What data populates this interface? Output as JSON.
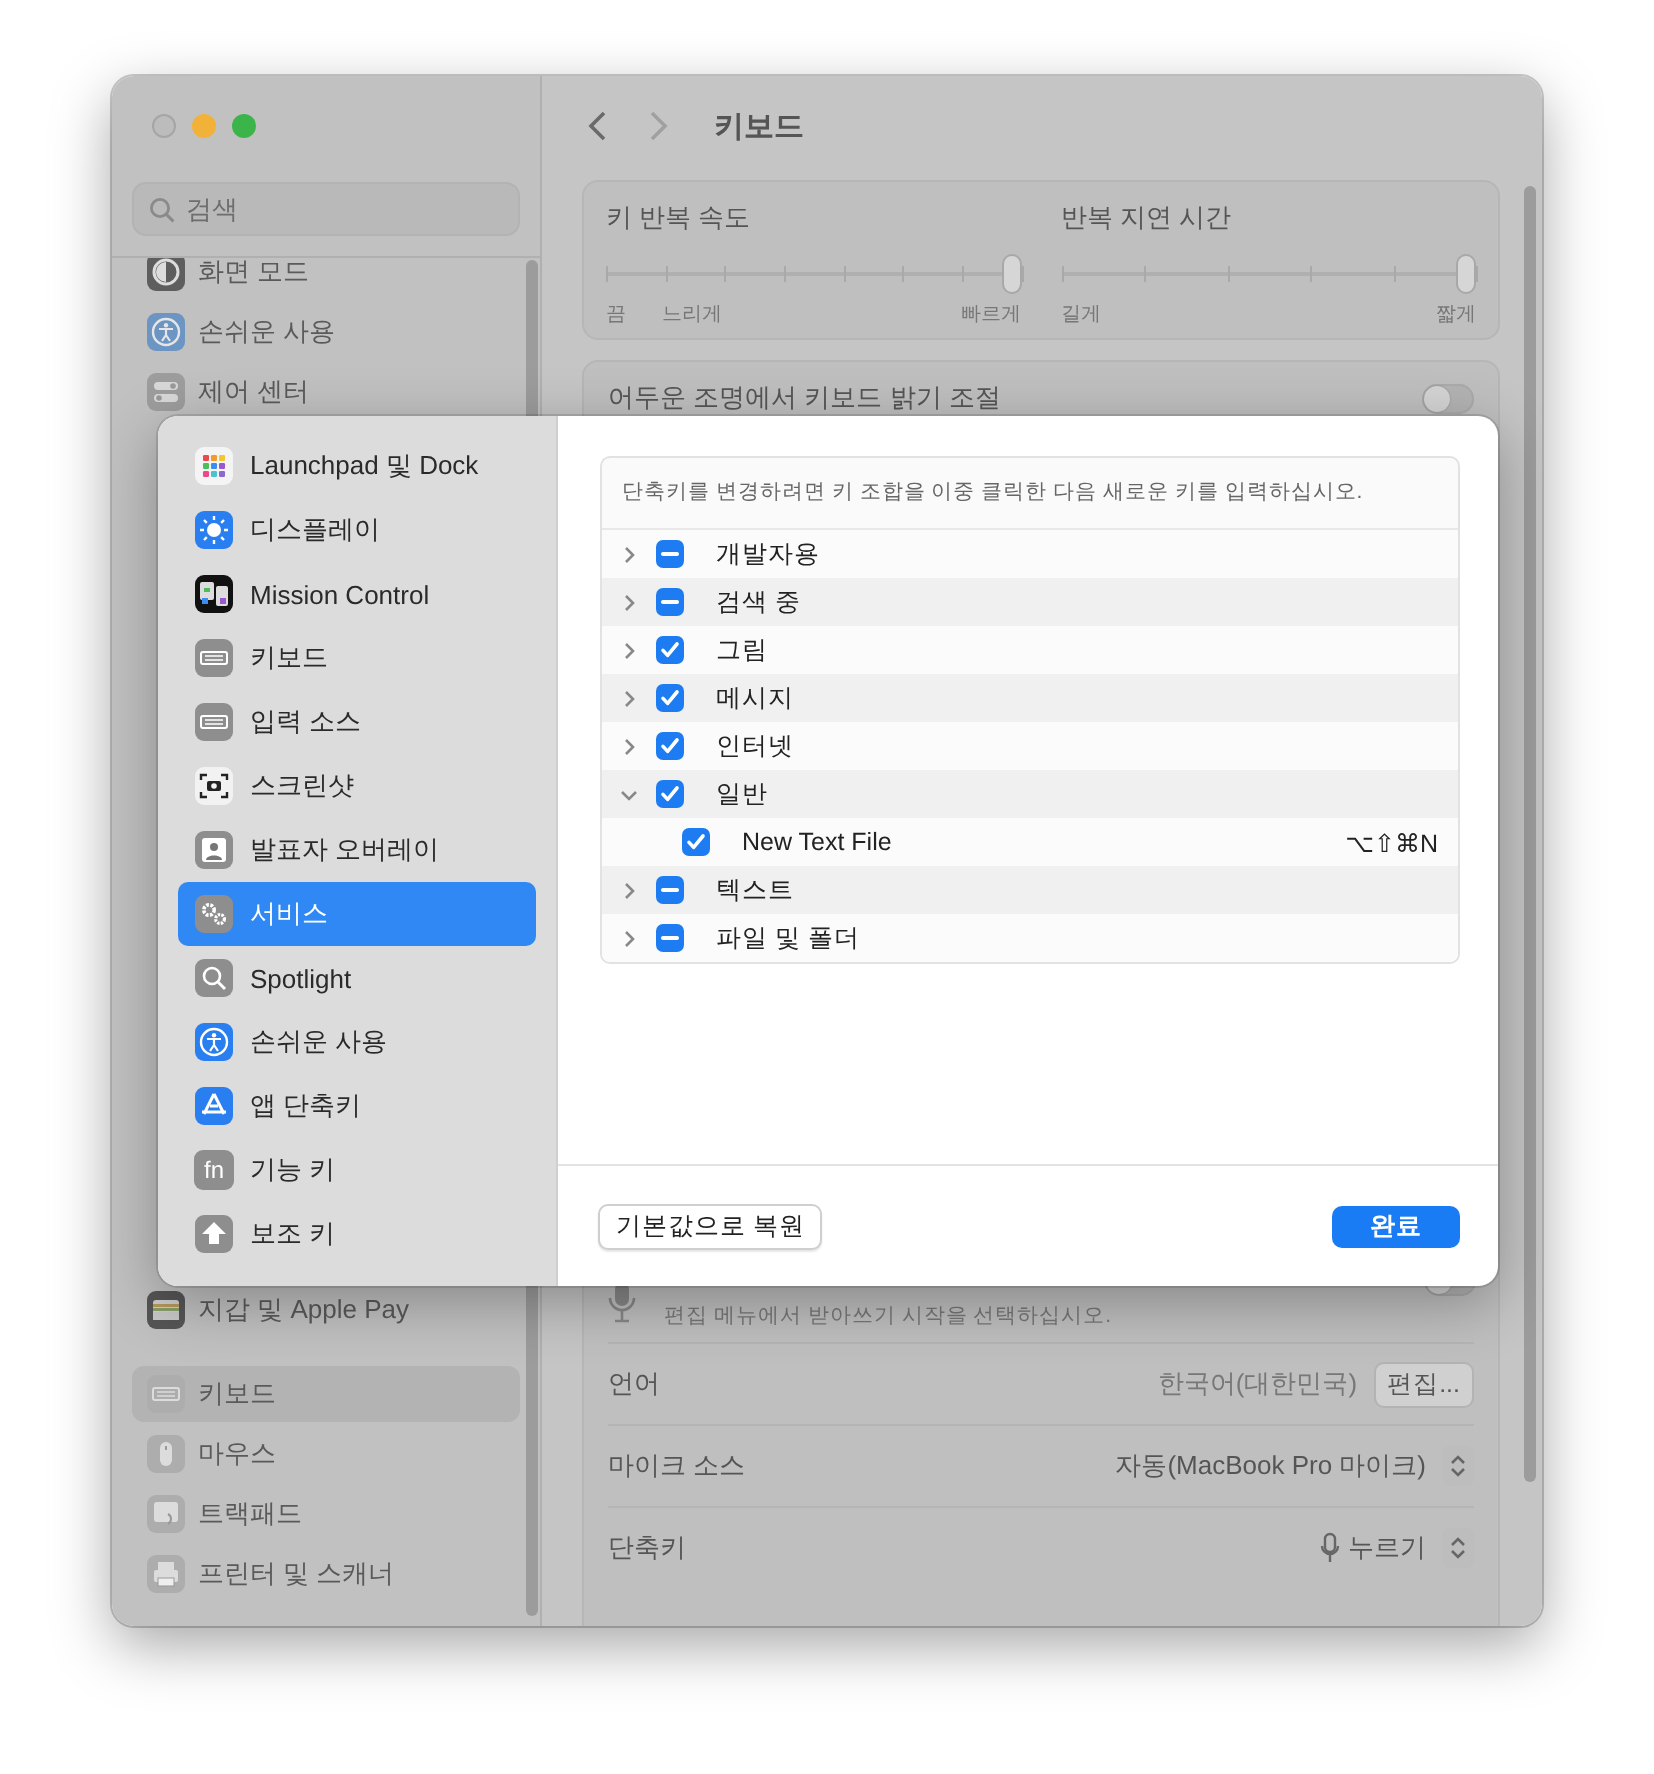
{
  "window": {
    "search": {
      "placeholder": "검색"
    }
  },
  "sidebar": {
    "sections": [
      {
        "items": [
          {
            "label": "화면 모드",
            "selected": false
          },
          {
            "label": "손쉬운 사용",
            "selected": false
          },
          {
            "label": "제어 센터",
            "selected": false
          }
        ]
      },
      {
        "items": [
          {
            "label": "지갑 및 Apple Pay",
            "selected": false
          }
        ]
      },
      {
        "items": [
          {
            "label": "키보드",
            "selected": true
          },
          {
            "label": "마우스",
            "selected": false
          },
          {
            "label": "트랙패드",
            "selected": false
          },
          {
            "label": "프린터 및 스캐너",
            "selected": false
          }
        ]
      }
    ]
  },
  "main": {
    "title": "키보드",
    "key_repeat": {
      "label": "키 반복 속도",
      "level": 1,
      "marks": [
        "끔",
        "느리게",
        "빠르게"
      ]
    },
    "repeat_delay": {
      "label": "반복 지연 시간",
      "level": 1,
      "marks": [
        "길게",
        "짧게"
      ]
    },
    "brightness": {
      "label": "어두운 조명에서 키보드 밝기 조절",
      "on": false
    },
    "dictation": {
      "text": "편집 메뉴에서 받아쓰기 시작을 선택하십시오.",
      "on": false
    },
    "rows": [
      {
        "kind": "button",
        "label": "언어",
        "value": "한국어(대한민국)",
        "button": "편집..."
      },
      {
        "kind": "popup",
        "label": "마이크 소스",
        "value": "자동(MacBook Pro 마이크)"
      },
      {
        "kind": "mic-popup",
        "label": "단축키",
        "value": "누르기"
      }
    ]
  },
  "sheet": {
    "sidebar": [
      {
        "label": "Launchpad 및 Dock",
        "selected": false
      },
      {
        "label": "디스플레이",
        "selected": false
      },
      {
        "label": "Mission Control",
        "selected": false
      },
      {
        "label": "키보드",
        "selected": false
      },
      {
        "label": "입력 소스",
        "selected": false
      },
      {
        "label": "스크린샷",
        "selected": false
      },
      {
        "label": "발표자 오버레이",
        "selected": false
      },
      {
        "label": "서비스",
        "selected": true
      },
      {
        "label": "Spotlight",
        "selected": false
      },
      {
        "label": "손쉬운 사용",
        "selected": false
      },
      {
        "label": "앱 단축키",
        "selected": false
      },
      {
        "label": "기능 키",
        "selected": false,
        "badge": "fn"
      },
      {
        "label": "보조 키",
        "selected": false
      }
    ],
    "hint": "단축키를 변경하려면 키 조합을 이중 클릭한 다음 새로운 키를 입력하십시오.",
    "services": [
      {
        "label": "개발자용",
        "checked": true,
        "mixed": true,
        "expanded": false
      },
      {
        "label": "검색 중",
        "checked": true,
        "mixed": true,
        "expanded": false
      },
      {
        "label": "그림",
        "checked": true,
        "mixed": false,
        "expanded": false
      },
      {
        "label": "메시지",
        "checked": true,
        "mixed": false,
        "expanded": false
      },
      {
        "label": "인터넷",
        "checked": true,
        "mixed": false,
        "expanded": false
      },
      {
        "label": "일반",
        "checked": true,
        "mixed": false,
        "expanded": true,
        "children": [
          {
            "label": "New Text File",
            "checked": true,
            "shortcut": "⌥⇧⌘N"
          }
        ]
      },
      {
        "label": "텍스트",
        "checked": true,
        "mixed": true,
        "expanded": false
      },
      {
        "label": "파일 및 폴더",
        "checked": true,
        "mixed": true,
        "expanded": false
      }
    ],
    "buttons": {
      "restore": "기본값으로 복원",
      "done": "완료"
    }
  }
}
